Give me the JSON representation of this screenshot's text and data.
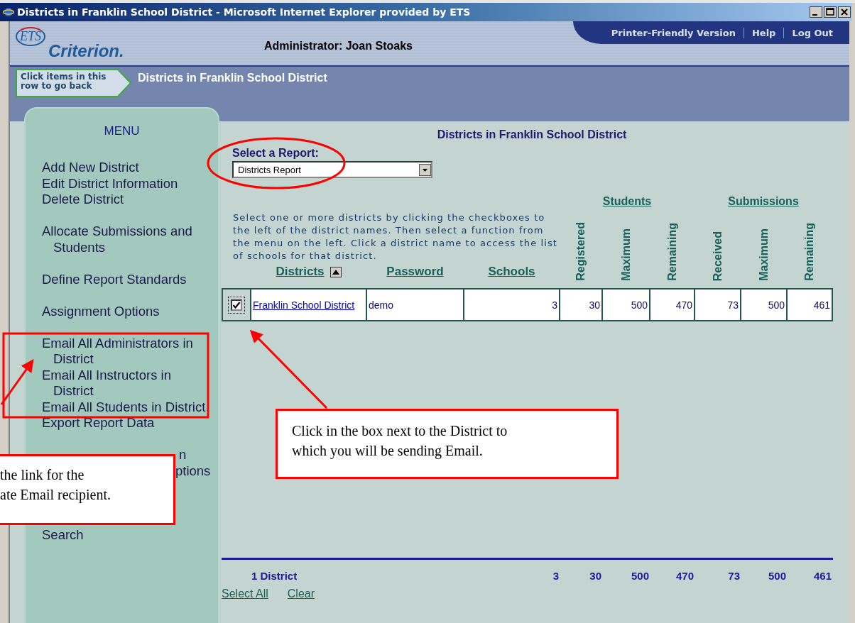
{
  "window": {
    "title": "Districts in Franklin School District - Microsoft Internet Explorer provided by ETS"
  },
  "header": {
    "logo_mark": "ETS",
    "logo_name": "Criterion.",
    "administrator": "Administrator: Joan Stoaks",
    "links": [
      "Printer-Friendly Version",
      "Help",
      "Log Out"
    ]
  },
  "breadcrumb": {
    "back_hint": "Click items in this row to go back",
    "current": "Districts in Franklin School District"
  },
  "menu": {
    "title": "MENU",
    "groups": [
      [
        {
          "kind": "link",
          "label": "Add New District"
        },
        {
          "kind": "link",
          "label": "Edit District Information"
        },
        {
          "kind": "link",
          "label": "Delete District"
        }
      ],
      [
        {
          "kind": "link",
          "label": "Allocate Submissions and Students"
        }
      ],
      [
        {
          "kind": "link",
          "label": "Define Report Standards"
        }
      ],
      [
        {
          "kind": "link",
          "label": "Assignment Options"
        }
      ],
      [
        {
          "kind": "link",
          "label": "Email All Administrators in District"
        },
        {
          "kind": "link",
          "label": "Email All Instructors in District"
        },
        {
          "kind": "link",
          "label": "Email All Students in District"
        },
        {
          "kind": "link",
          "label": "Export Report Data"
        }
      ],
      [
        {
          "kind": "fragment",
          "label": "n"
        },
        {
          "kind": "fragment",
          "label": "ptions"
        }
      ],
      [
        {
          "kind": "link",
          "label": "Search"
        }
      ]
    ]
  },
  "main": {
    "title": "Districts in Franklin School District",
    "report_label": "Select a Report:",
    "report_value": "Districts Report",
    "instructions": "Select one or more districts by clicking the checkboxes to the left of the district names. Then select a function from the menu on the left. Click a district name to access the list of schools for that district.",
    "column_groups": [
      "Students",
      "Submissions"
    ],
    "columns": [
      {
        "kind": "text",
        "label": "Districts",
        "sorted": true
      },
      {
        "kind": "text",
        "label": "Password"
      },
      {
        "kind": "text",
        "label": "Schools"
      },
      {
        "kind": "rotated",
        "label": "Registered"
      },
      {
        "kind": "rotated",
        "label": "Maximum"
      },
      {
        "kind": "rotated",
        "label": "Remaining"
      },
      {
        "kind": "rotated",
        "label": "Received"
      },
      {
        "kind": "rotated",
        "label": "Maximum"
      },
      {
        "kind": "rotated",
        "label": "Remaining"
      }
    ],
    "rows": [
      {
        "checked": true,
        "cells": [
          "Franklin School District",
          "demo",
          "3",
          "30",
          "500",
          "470",
          "73",
          "500",
          "461"
        ]
      }
    ],
    "totals": {
      "label": "1 District",
      "values": [
        "3",
        "30",
        "500",
        "470",
        "73",
        "500",
        "461"
      ]
    },
    "actions": [
      "Select All",
      "Clear"
    ]
  },
  "callouts": [
    {
      "lines": [
        "Click in the box next to the District to",
        "which you will be sending Email."
      ]
    },
    {
      "lines": [
        "the link for the",
        "ate Email recipient."
      ]
    }
  ]
}
